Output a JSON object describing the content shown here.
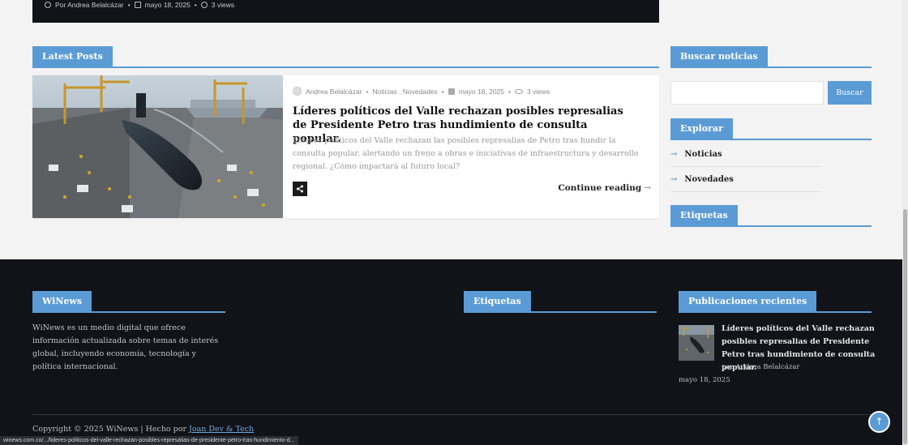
{
  "hero": {
    "author": "Por Andrea Belalcázar",
    "date": "mayo 18, 2025",
    "views": "3 views"
  },
  "latest": {
    "heading": "Latest Posts",
    "post": {
      "author": "Andrea Belalcázar",
      "categories": "Noticias , Novedades",
      "date": "mayo 18, 2025",
      "views": "3 views",
      "title": "Líderes políticos del Valle rechazan posibles represalias de Presidente Petro tras hundimiento de consulta popular.",
      "excerpt": "Líderes políticos del Valle rechazan las posibles represalias de Petro tras hundir la consulta popular, alertando un freno a obras e iniciativas de infraestructura y desarrollo regional. ¿Cómo impactará al futuro local?",
      "continue": "Continue reading"
    }
  },
  "sidebar": {
    "search_heading": "Buscar noticias",
    "search_button": "Buscar",
    "explore_heading": "Explorar",
    "explore_items": [
      "Noticias",
      "Novedades"
    ],
    "tags_heading": "Etiquetas"
  },
  "footer": {
    "about_heading": "WiNews",
    "about_text": "WiNews es un medio digital que ofrece información actualizada sobre temas de interés global, incluyendo economía, tecnología y política internacional.",
    "tags_heading": "Etiquetas",
    "recent_heading": "Publicaciones recientes",
    "recent_post": {
      "title": "Líderes políticos del Valle rechazan posibles represalias de Presidente Petro tras hundimiento de consulta popular.",
      "author": "por Andrea Belalcázar",
      "date": "mayo 18, 2025"
    },
    "copyright_prefix": "Copyright © 2025 WiNews | Hecho por ",
    "copyright_link": "Joan Dev & Tech"
  },
  "status_url": "winews.com.co/.../lideres-politicos-del-valle-rechazan-posibles-represalias-de-presidente-petro-tras-hundimiento-d...",
  "colors": {
    "accent": "#5b9bd5",
    "footer_bg": "#111318",
    "page_bg": "#f3f3f3"
  }
}
